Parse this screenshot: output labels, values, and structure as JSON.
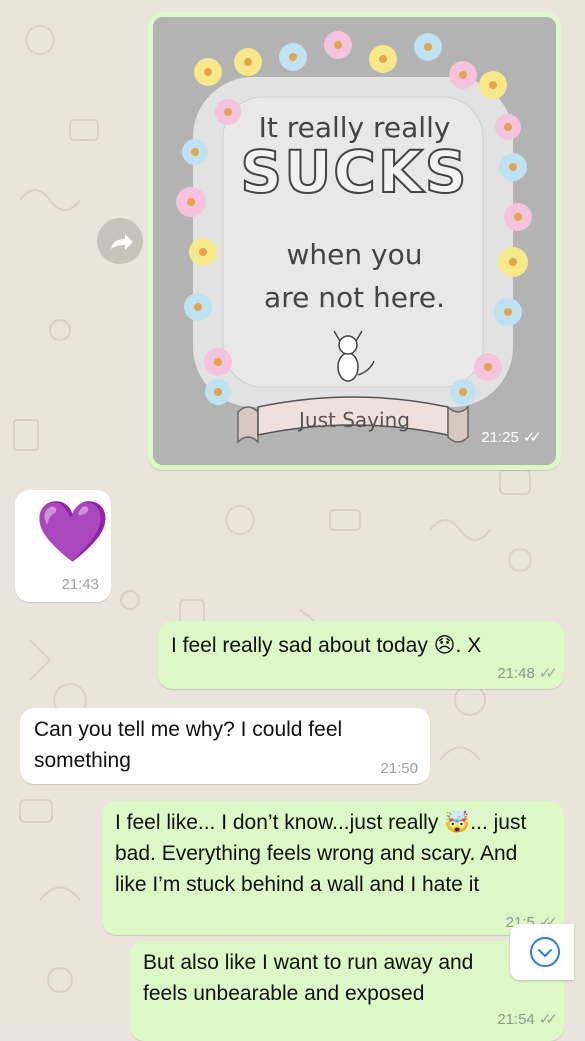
{
  "chat": {
    "image_message": {
      "card_lines": [
        "It really really",
        "SUCKS",
        "when you",
        "are not here."
      ],
      "banner_text": "Just Saying",
      "time": "21:25",
      "status_icon": "double-check-icon"
    },
    "messages": [
      {
        "direction": "in",
        "text": "💜",
        "time": "21:43"
      },
      {
        "direction": "out",
        "text": "I feel really sad about today 😞. X",
        "time": "21:48"
      },
      {
        "direction": "in",
        "text": "Can you tell me why? I could feel something",
        "time": "21:50"
      },
      {
        "direction": "out",
        "text": "I feel like... I don’t know...just really 🤯... just bad. Everything feels wrong and scary. And like I’m stuck behind a wall and I hate it",
        "time": "21:5"
      },
      {
        "direction": "out",
        "text": "But also like I want to run away and feels unbearable and exposed",
        "time": "21:54"
      }
    ]
  },
  "controls": {
    "forward_icon": "forward-arrow-icon",
    "scroll_icon": "chevron-down-icon"
  },
  "colors": {
    "outgoing_bubble": "#dcf8c6",
    "incoming_bubble": "#ffffff",
    "wallpaper": "#ece5dd",
    "accent_blue": "#2a7be4"
  }
}
